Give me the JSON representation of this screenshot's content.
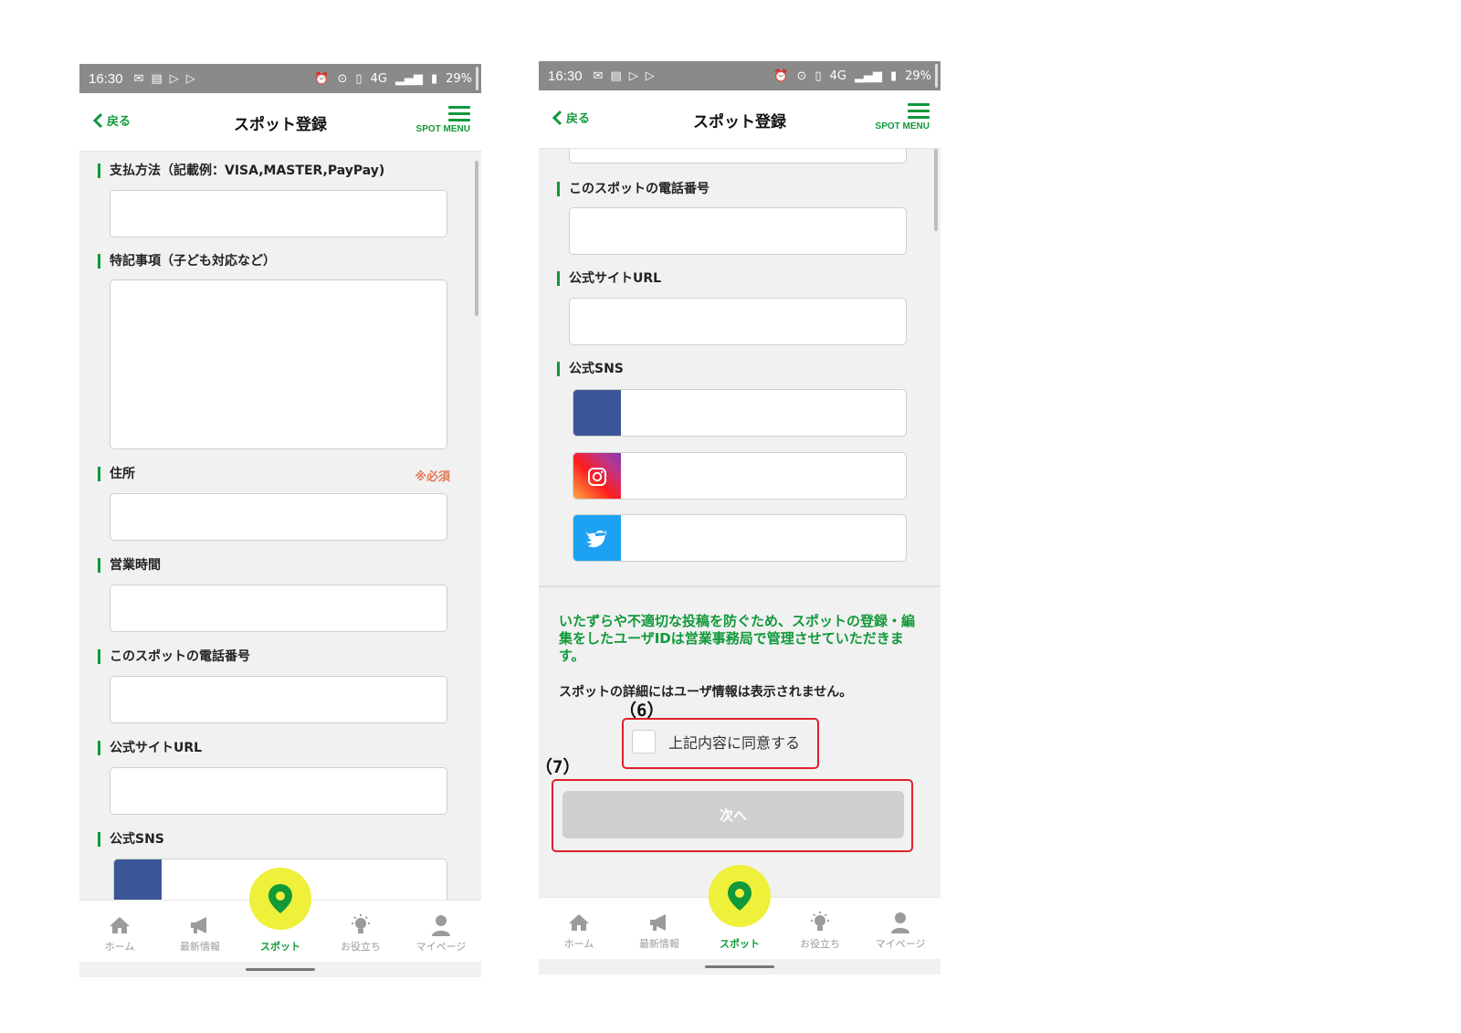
{
  "status_bar": {
    "time": "16:30",
    "network": "4G",
    "battery": "29%"
  },
  "app_bar": {
    "back_label": "戻る",
    "title": "スポット登録",
    "menu_label": "SPOT MENU"
  },
  "left_form": {
    "payment_label": "支払方法（記載例：VISA,MASTER,PayPay)",
    "notes_label": "特記事項（子ども対応など）",
    "address_label": "住所",
    "required_mark": "※必須",
    "hours_label": "営業時間",
    "phone_label": "このスポットの電話番号",
    "url_label": "公式サイトURL",
    "sns_label": "公式SNS"
  },
  "right_form": {
    "phone_label": "このスポットの電話番号",
    "url_label": "公式サイトURL",
    "sns_label": "公式SNS",
    "notice": "いたずらや不適切な投稿を防ぐため、スポットの登録・編集をしたユーザIDは営業事務局で管理させていただきます。",
    "note2": "スポットの詳細にはユーザ情報は表示されません。",
    "annotation_6": "（6）",
    "agree_label": "上記内容に同意する",
    "annotation_7": "（7）",
    "next_button": "次へ"
  },
  "bottom_nav": {
    "home": "ホーム",
    "news": "最新情報",
    "spot": "スポット",
    "useful": "お役立ち",
    "mypage": "マイページ"
  },
  "colors": {
    "accent": "#11993a",
    "required": "#e07a52",
    "fab": "#eef03a",
    "annotation_box": "#e0202a",
    "facebook": "#3b5696",
    "twitter": "#1da1f2"
  }
}
